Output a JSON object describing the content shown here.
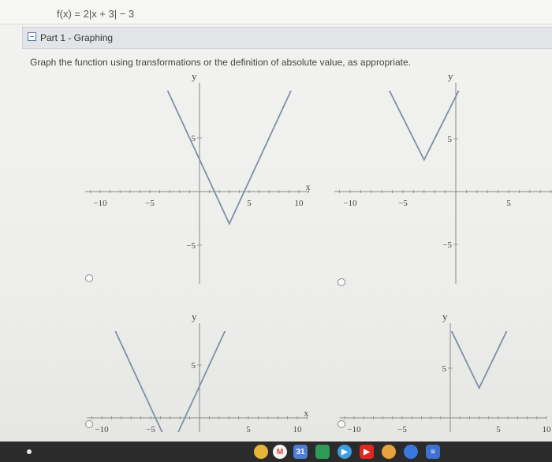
{
  "header": {
    "function_text": "f(x) = 2|x + 3| − 3"
  },
  "part": {
    "title": "Part 1 - Graphing"
  },
  "instruction": "Graph the function using transformations or the definition of absolute value, as appropriate.",
  "graphs": [
    {
      "id": "A",
      "axis_x": "x",
      "axis_y": "y",
      "x_ticks": [
        "−10",
        "−5",
        "5",
        "10"
      ],
      "y_ticks": [
        "5",
        "−5"
      ],
      "vertex": [
        3,
        -3
      ],
      "slope": 2
    },
    {
      "id": "B",
      "axis_x": "",
      "axis_y": "y",
      "x_ticks": [
        "−10",
        "−5",
        "5"
      ],
      "y_ticks": [
        "5",
        "−5"
      ],
      "vertex": [
        -3,
        3
      ],
      "slope": 2
    },
    {
      "id": "C",
      "axis_x": "x",
      "axis_y": "y",
      "x_ticks": [
        "−10",
        "−5",
        "5",
        "10"
      ],
      "y_ticks": [
        "5"
      ],
      "vertex": [
        -3,
        -3
      ],
      "slope": 2
    },
    {
      "id": "D",
      "axis_x": "",
      "axis_y": "y",
      "x_ticks": [
        "−10",
        "−5",
        "5",
        "10"
      ],
      "y_ticks": [
        "5"
      ],
      "vertex": [
        3,
        3
      ],
      "slope": 2
    }
  ],
  "colors": {
    "curve": "#7f8fa8",
    "axis": "#888888",
    "grid": "#d0d0d0"
  },
  "dock": {
    "icons": [
      "chrome-icon",
      "gmail-icon",
      "calendar-icon",
      "classroom-icon",
      "play-icon",
      "youtube-icon",
      "photos-icon",
      "messages-icon",
      "docs-icon"
    ]
  }
}
